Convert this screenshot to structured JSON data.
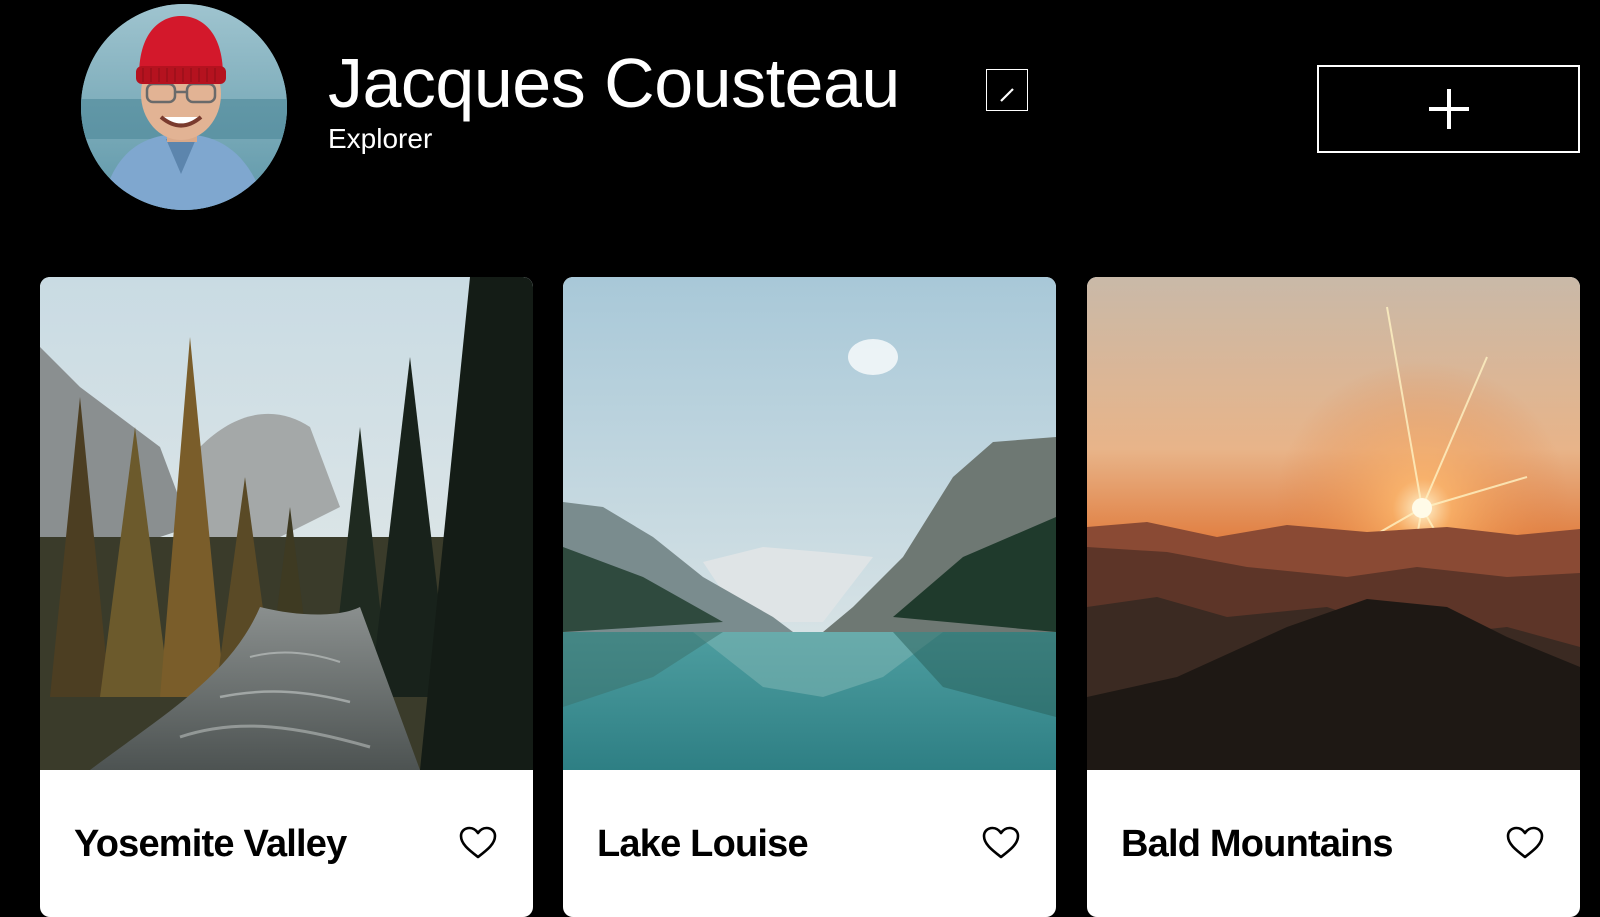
{
  "profile": {
    "name": "Jacques Cousteau",
    "about": "Explorer",
    "avatar_icon": "person-portrait-red-beanie",
    "edit_icon": "pencil-icon",
    "add_icon": "plus-icon"
  },
  "cards": [
    {
      "title": "Yosemite Valley",
      "image_icon": "forest-river-photo",
      "like_icon": "heart-outline-icon",
      "liked": false
    },
    {
      "title": "Lake Louise",
      "image_icon": "mountain-lake-photo",
      "like_icon": "heart-outline-icon",
      "liked": false
    },
    {
      "title": "Bald Mountains",
      "image_icon": "sunset-mountains-photo",
      "like_icon": "heart-outline-icon",
      "liked": false
    }
  ],
  "colors": {
    "background": "#000000",
    "card_background": "#ffffff",
    "text_primary": "#ffffff",
    "card_text": "#000000"
  }
}
